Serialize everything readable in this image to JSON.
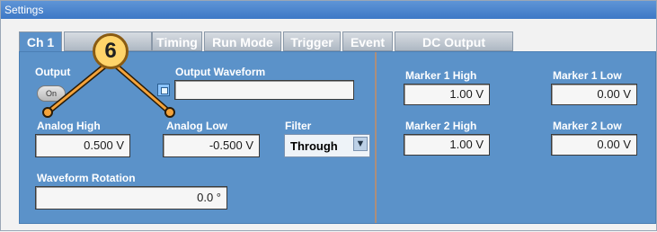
{
  "window": {
    "title": "Settings"
  },
  "tabs": [
    {
      "label": "Ch 1",
      "active": true
    },
    {
      "label": "",
      "active": false
    },
    {
      "label": "Timing",
      "active": false
    },
    {
      "label": "Run Mode",
      "active": false
    },
    {
      "label": "Trigger",
      "active": false
    },
    {
      "label": "Event",
      "active": false
    },
    {
      "label": "DC Output",
      "active": false
    }
  ],
  "left_panel": {
    "output": {
      "label": "Output",
      "toggle_text": "On"
    },
    "output_waveform": {
      "label": "Output Waveform",
      "value": ""
    },
    "analog_high": {
      "label": "Analog High",
      "value": "0.500 V"
    },
    "analog_low": {
      "label": "Analog Low",
      "value": "-0.500 V"
    },
    "filter": {
      "label": "Filter",
      "value": "Through"
    },
    "waveform_rotation": {
      "label": "Waveform Rotation",
      "value": "0.0 °"
    }
  },
  "right_panel": {
    "marker1_high": {
      "label": "Marker 1 High",
      "value": "1.00 V"
    },
    "marker1_low": {
      "label": "Marker 1 Low",
      "value": "0.00 V"
    },
    "marker2_high": {
      "label": "Marker 2 High",
      "value": "1.00 V"
    },
    "marker2_low": {
      "label": "Marker 2 Low",
      "value": "0.00 V"
    }
  },
  "callout": {
    "number": "6"
  },
  "colors": {
    "panel": "#5b92c9",
    "title": "#3d78c6",
    "callout": "#ffd46a"
  }
}
